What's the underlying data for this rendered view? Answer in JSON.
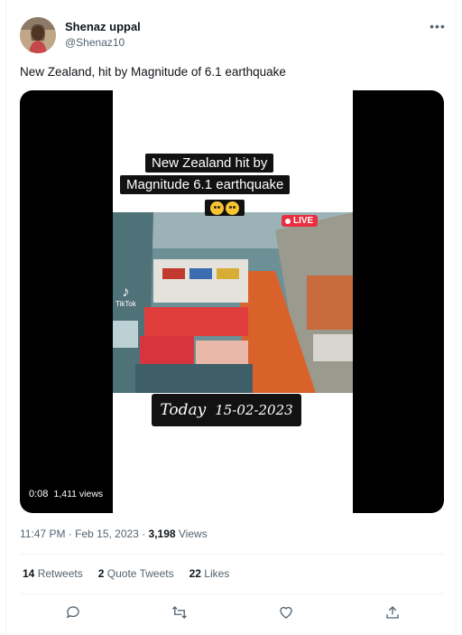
{
  "author": {
    "name": "Shenaz uppal",
    "handle": "@Shenaz10"
  },
  "more_icon": "more-horizontal-icon",
  "tweet": {
    "text": "New Zealand, hit by Magnitude of 6.1 earthquake"
  },
  "video": {
    "caption_line1": "New Zealand hit by",
    "caption_line2": "Magnitude 6.1 earthquake",
    "live_label": "LIVE",
    "watermark": "TikTok",
    "date_today": "Today",
    "date_value": "15-02-2023",
    "duration": "0:08",
    "views": "1,411 views"
  },
  "meta": {
    "time": "11:47 PM · Feb 15, 2023 · ",
    "views_count": "3,198",
    "views_label": " Views"
  },
  "stats": {
    "retweets_count": "14",
    "retweets_label": "Retweets",
    "quotes_count": "2",
    "quotes_label": "Quote Tweets",
    "likes_count": "22",
    "likes_label": "Likes"
  },
  "actions": [
    "reply-icon",
    "retweet-icon",
    "like-icon",
    "share-icon"
  ],
  "colors": {
    "text": "#0f1419",
    "secondary": "#536471",
    "live": "#ea2d3f",
    "divider": "#eff3f4"
  }
}
